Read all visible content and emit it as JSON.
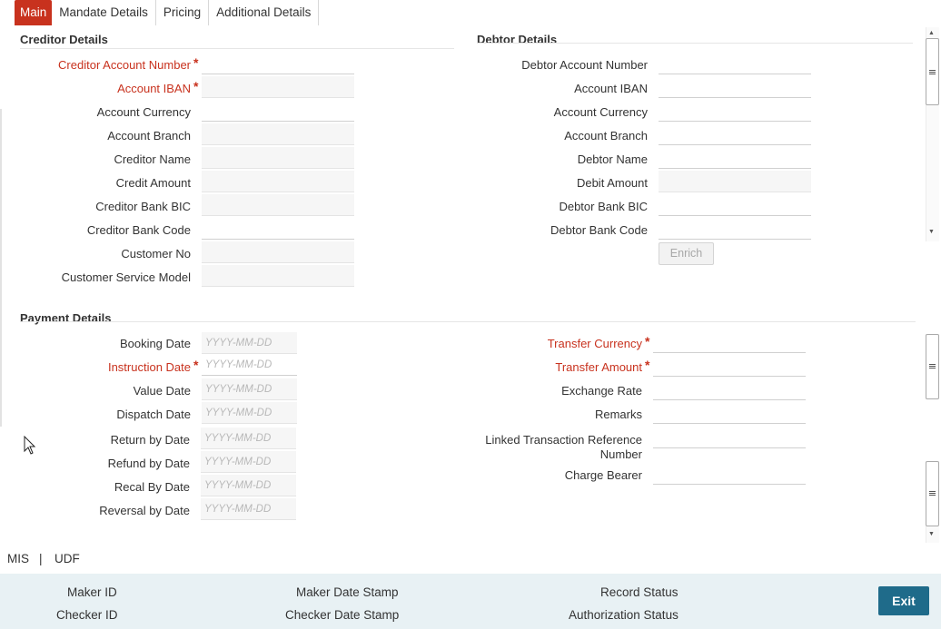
{
  "tabs": [
    {
      "label": "Main"
    },
    {
      "label": "Mandate Details"
    },
    {
      "label": "Pricing"
    },
    {
      "label": "Additional Details"
    }
  ],
  "creditor": {
    "title": "Creditor Details",
    "fields": {
      "account_number": "Creditor Account Number",
      "account_iban": "Account IBAN",
      "account_currency": "Account Currency",
      "account_branch": "Account Branch",
      "name": "Creditor Name",
      "credit_amount": "Credit Amount",
      "bank_bic": "Creditor Bank BIC",
      "bank_code": "Creditor Bank Code",
      "customer_no": "Customer No",
      "customer_service_model": "Customer Service Model"
    }
  },
  "debtor": {
    "title": "Debtor Details",
    "fields": {
      "account_number": "Debtor Account Number",
      "account_iban": "Account IBAN",
      "account_currency": "Account Currency",
      "account_branch": "Account Branch",
      "name": "Debtor Name",
      "debit_amount": "Debit Amount",
      "bank_bic": "Debtor Bank BIC",
      "bank_code": "Debtor Bank Code"
    },
    "enrich_label": "Enrich"
  },
  "payment": {
    "title": "Payment Details",
    "date_placeholder": "YYYY-MM-DD",
    "dates": {
      "booking": "Booking Date",
      "instruction": "Instruction Date",
      "value": "Value Date",
      "dispatch": "Dispatch Date",
      "return_by": "Return by Date",
      "refund_by": "Refund by Date",
      "recal_by": "Recal By Date",
      "reversal_by": "Reversal by Date"
    },
    "transfer_currency": "Transfer Currency",
    "transfer_amount": "Transfer Amount",
    "exchange_rate": "Exchange Rate",
    "remarks": "Remarks",
    "linked_ref_line1": "Linked Transaction Reference",
    "linked_ref_line2": "Number",
    "charge_bearer": "Charge Bearer"
  },
  "required_mark": "*",
  "bottom_links": {
    "mis": "MIS",
    "separator": "|",
    "udf": "UDF"
  },
  "footer": {
    "maker_id": "Maker ID",
    "checker_id": "Checker ID",
    "maker_date_stamp": "Maker Date Stamp",
    "checker_date_stamp": "Checker Date Stamp",
    "record_status": "Record Status",
    "authorization_status": "Authorization Status",
    "exit_label": "Exit"
  },
  "colors": {
    "accent": "#c8321e",
    "footer_bg": "#e8f1f4",
    "exit_button": "#1f6b8a"
  }
}
